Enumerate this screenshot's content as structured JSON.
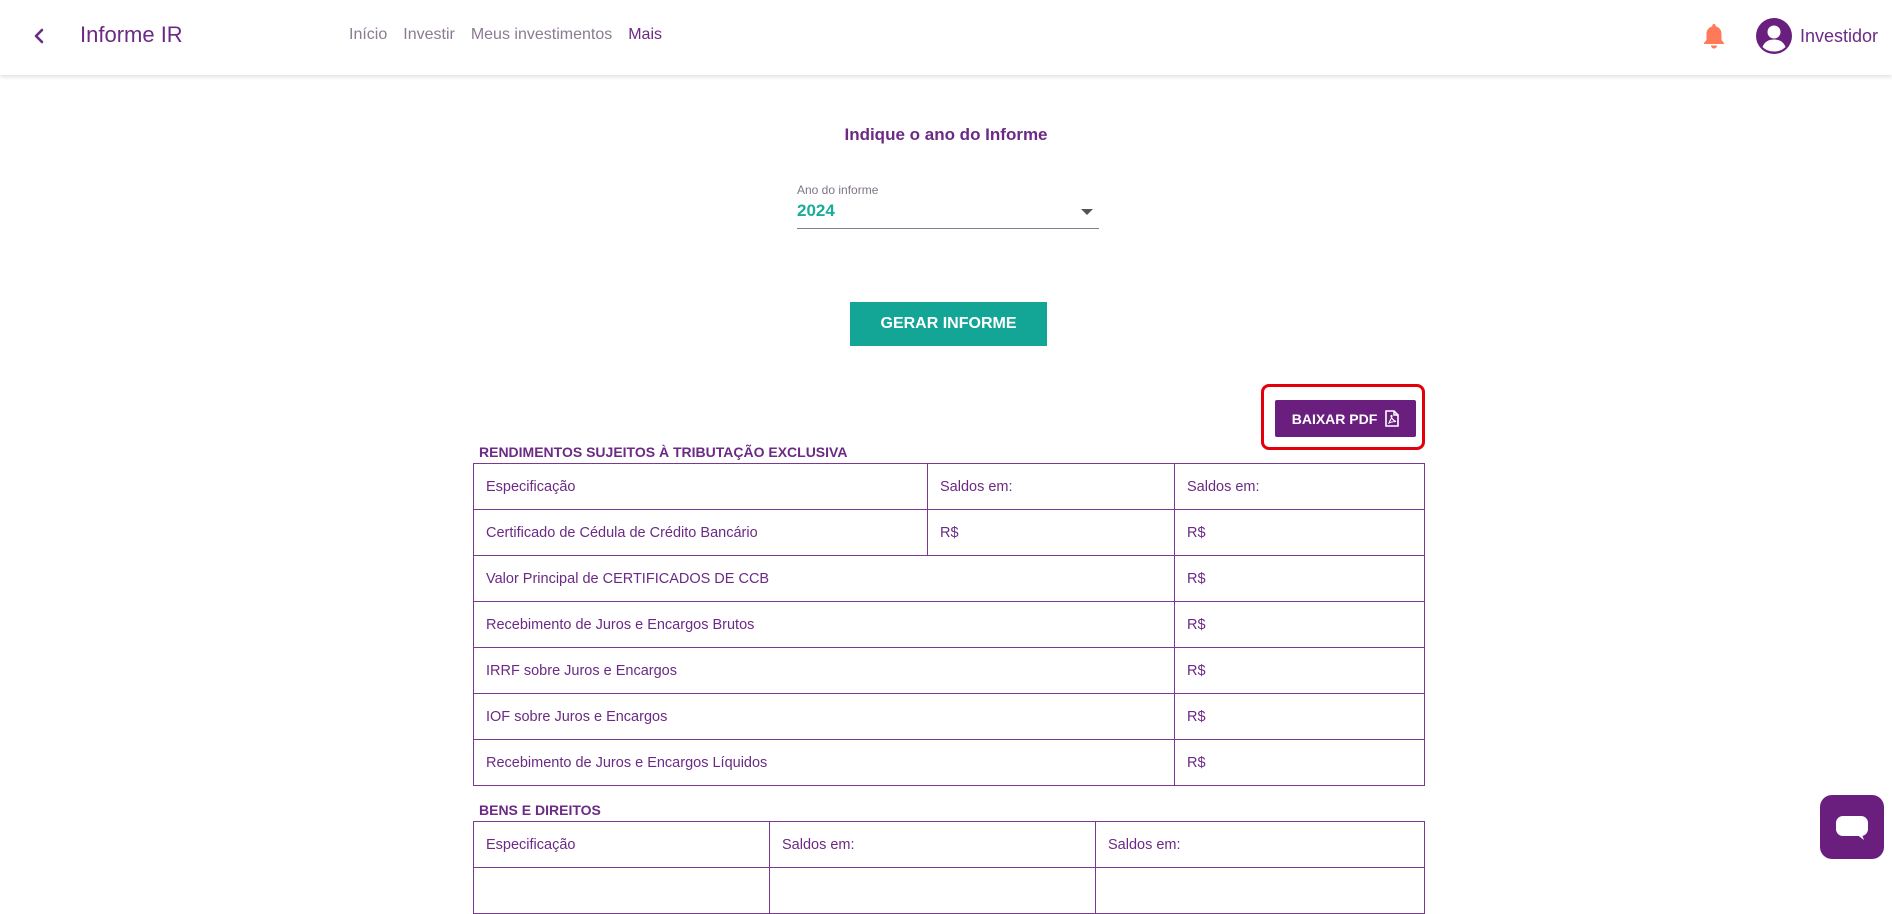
{
  "header": {
    "title": "Informe IR",
    "nav": [
      "Início",
      "Investir",
      "Meus investimentos",
      "Mais"
    ],
    "user_name": "Investidor"
  },
  "form": {
    "heading": "Indique o ano do Informe",
    "year_label": "Ano do informe",
    "year_value": "2024",
    "generate_label": "GERAR INFORME",
    "download_label": "BAIXAR PDF"
  },
  "section1": {
    "title": "RENDIMENTOS SUJEITOS À TRIBUTAÇÃO EXCLUSIVA",
    "header": [
      "Especificação",
      "Saldos em:",
      "Saldos em:"
    ],
    "ccb_row": [
      "Certificado de Cédula de Crédito Bancário",
      "R$",
      "R$"
    ],
    "rows": [
      [
        "Valor Principal de CERTIFICADOS DE CCB",
        "R$"
      ],
      [
        "Recebimento de Juros e Encargos Brutos",
        "R$"
      ],
      [
        "IRRF sobre Juros e Encargos",
        "R$"
      ],
      [
        "IOF sobre Juros e Encargos",
        "R$"
      ],
      [
        "Recebimento de Juros e Encargos Líquidos",
        "R$"
      ]
    ]
  },
  "section2": {
    "title": "BENS E DIREITOS",
    "header": [
      "Especificação",
      "Saldos em:",
      "Saldos em:"
    ]
  },
  "colors": {
    "primary": "#6a1f7f",
    "accent": "#13a595",
    "bell": "#ff7a59",
    "highlight": "#e3000b"
  }
}
